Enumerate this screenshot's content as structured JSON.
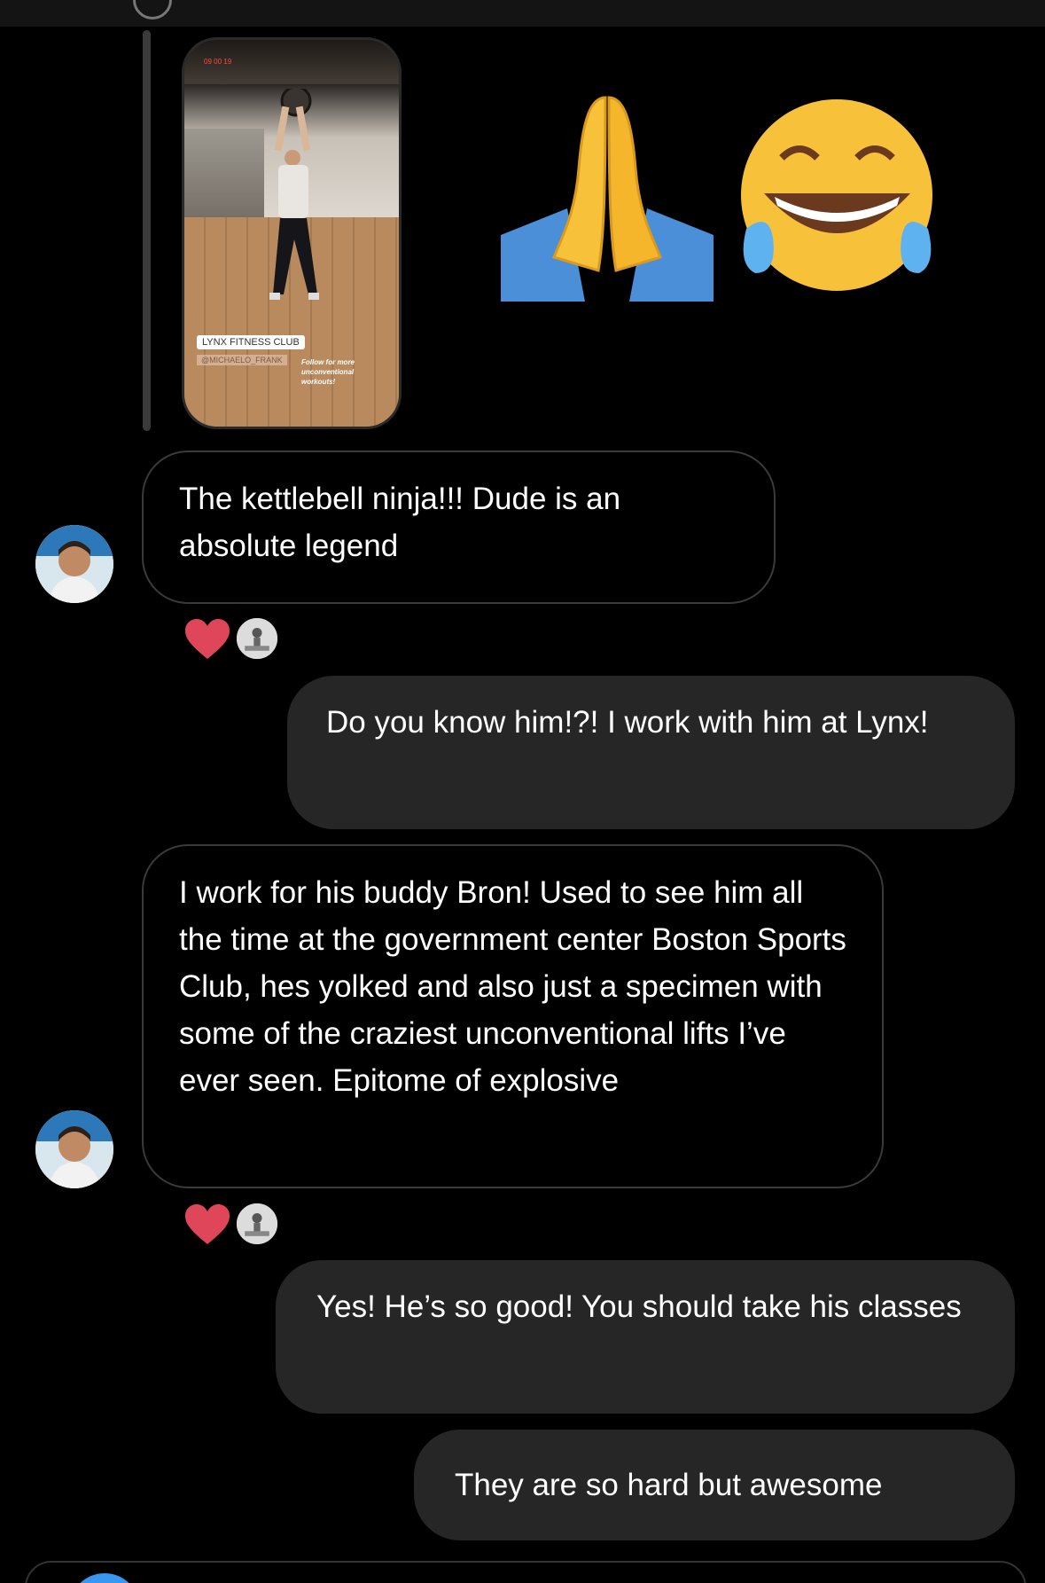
{
  "story": {
    "time_label": "09 00 19",
    "location_sticker": "LYNX FITNESS CLUB",
    "handle": "@MICHAELO_FRANK",
    "caption": "Follow for more unconventional workouts!"
  },
  "messages": [
    {
      "direction": "incoming",
      "text": "The kettlebell ninja!!! Dude is an absolute legend"
    },
    {
      "direction": "outgoing",
      "text": "Do you know him!?! I work with him at Lynx!"
    },
    {
      "direction": "incoming",
      "text": "I work for his buddy Bron! Used to see him all the time at the government center Boston Sports Club, hes yolked and also just a specimen with some of the craziest unconventional lifts I’ve ever seen. Epitome of explosive"
    },
    {
      "direction": "outgoing",
      "text": "Yes! He’s so good! You should take his classes"
    },
    {
      "direction": "outgoing",
      "text": "They are so hard but awesome"
    }
  ],
  "reactions": [
    "heart",
    "heart"
  ],
  "icons": {
    "story_reply": [
      "folded-hands-emoji",
      "tears-of-joy-emoji"
    ],
    "reaction": "heart-icon"
  },
  "colors": {
    "background": "#000000",
    "outgoing_bubble": "#262626",
    "incoming_border": "#3a3a3a",
    "heart": "#e0465a",
    "composer_camera": "#3897f0"
  }
}
